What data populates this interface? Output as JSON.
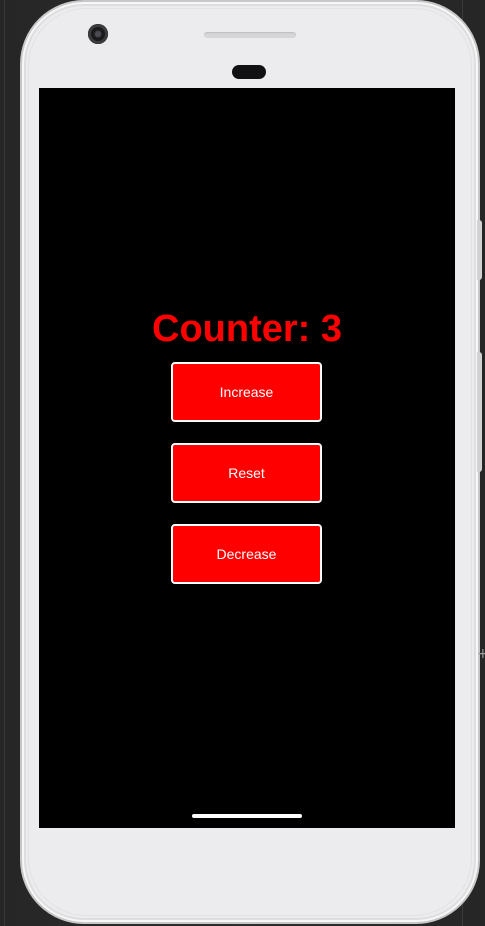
{
  "app": {
    "counter_label": "Counter: 3",
    "count_value": 3
  },
  "buttons": {
    "increase_label": "Increase",
    "reset_label": "Reset",
    "decrease_label": "Decrease"
  },
  "emulator": {
    "plus_glyph": "+"
  },
  "colors": {
    "screen_background": "#000000",
    "accent_red": "#ff0000",
    "button_border": "#ffffff",
    "phone_body": "#ececee"
  }
}
